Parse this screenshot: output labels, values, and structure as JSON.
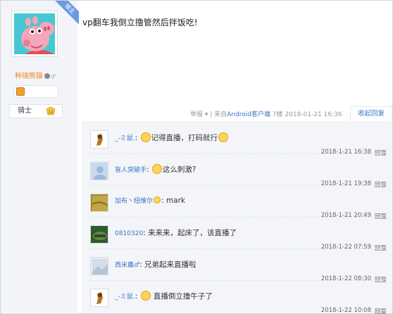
{
  "profile": {
    "ribbon": "楼主",
    "username": "种瑞熊猫",
    "rank": "骑士",
    "level": "12"
  },
  "post": {
    "text": "vp翻车我倒立撸管然后拌饭吃!",
    "report": "举报",
    "from_label": "来自",
    "client": "Android客户端",
    "floor": "7楼",
    "datetime": "2018-01-21 16:36",
    "reply_label": "收起回复"
  },
  "replies": [
    {
      "name": "_-ミ鼠.",
      "text_before": "",
      "text": "记得直播，打码就行",
      "time": "2018-1-21 16:38",
      "reply": "回复"
    },
    {
      "name": "盲人突破手",
      "text": "这么刺激?",
      "time": "2018-1-21 19:38",
      "reply": "回复"
    },
    {
      "name": "加布丶纽维尔",
      "text": "mark",
      "time": "2018-1-21 20:49",
      "reply": "回复"
    },
    {
      "name": "0810320",
      "text": "来来来，起床了，该直播了",
      "time": "2018-1-22 07:59",
      "reply": "回复"
    },
    {
      "name": "西米農♂",
      "text": "兄弟起来直播啦",
      "time": "2018-1-22 08:30",
      "reply": "回复"
    },
    {
      "name": "_-ミ鼠.",
      "text": "直播倒立撸牛子了",
      "time": "2018-1-22 10:08",
      "reply": "回复"
    }
  ],
  "colors": {
    "link": "#3a73c8",
    "username": "#f08a2c",
    "sidebar": "#f2f4f8",
    "reply_bg": "#f3f5f8"
  }
}
